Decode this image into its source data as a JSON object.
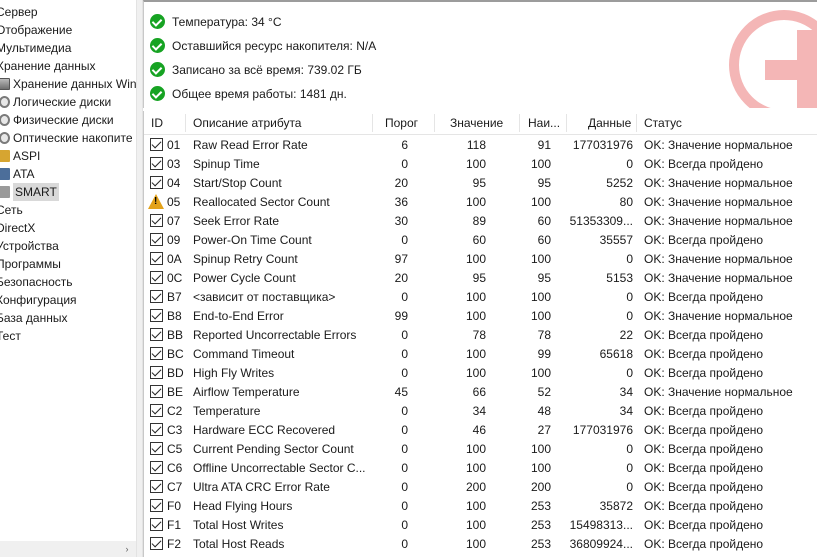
{
  "tree": {
    "items": [
      {
        "label": "Сервер",
        "indent": 0,
        "icon": ""
      },
      {
        "label": "Отображение",
        "indent": 0,
        "icon": ""
      },
      {
        "label": "Мультимедиа",
        "indent": 0,
        "icon": ""
      },
      {
        "label": "Хранение данных",
        "indent": 0,
        "icon": ""
      },
      {
        "label": "Хранение данных Win",
        "indent": 1,
        "icon": "hdd-icon"
      },
      {
        "label": "Логические диски",
        "indent": 1,
        "icon": "disk-icon"
      },
      {
        "label": "Физические диски",
        "indent": 1,
        "icon": "disk-icon"
      },
      {
        "label": "Оптические накопите",
        "indent": 1,
        "icon": "disk-icon"
      },
      {
        "label": "ASPI",
        "indent": 1,
        "icon": "folder-icon"
      },
      {
        "label": "ATA",
        "indent": 1,
        "icon": "chip-icon"
      },
      {
        "label": "SMART",
        "indent": 1,
        "icon": "smart-icon",
        "selected": true
      },
      {
        "label": "Сеть",
        "indent": 0,
        "icon": ""
      },
      {
        "label": "DirectX",
        "indent": 0,
        "icon": ""
      },
      {
        "label": "Устройства",
        "indent": 0,
        "icon": ""
      },
      {
        "label": "Программы",
        "indent": 0,
        "icon": ""
      },
      {
        "label": "Безопасность",
        "indent": 0,
        "icon": ""
      },
      {
        "label": "Конфигурация",
        "indent": 0,
        "icon": ""
      },
      {
        "label": "База данных",
        "indent": 0,
        "icon": ""
      },
      {
        "label": "Тест",
        "indent": 0,
        "icon": ""
      }
    ],
    "scroll_arrow": "›"
  },
  "info": {
    "rows": [
      {
        "text": "Температура: 34 °C",
        "icon": "ok-icon"
      },
      {
        "text": "Оставшийся ресурс накопителя: N/A",
        "icon": "ok-icon"
      },
      {
        "text": "Записано за всё время: 739.02 ГБ",
        "icon": "ok-icon"
      },
      {
        "text": "Общее время работы: 1481 дн.",
        "icon": "ok-icon"
      }
    ],
    "health_icon": "health-cross-icon"
  },
  "table": {
    "headers": {
      "id": "ID",
      "desc": "Описание атрибута",
      "threshold": "Порог",
      "value": "Значение",
      "worst": "Наи...",
      "data": "Данные",
      "status": "Статус"
    },
    "rows": [
      {
        "icon": "check",
        "id": "01",
        "desc": "Raw Read Error Rate",
        "threshold": "6",
        "value": "118",
        "worst": "91",
        "data": "177031976",
        "status": "OK: Значение нормальное"
      },
      {
        "icon": "check",
        "id": "03",
        "desc": "Spinup Time",
        "threshold": "0",
        "value": "100",
        "worst": "100",
        "data": "0",
        "status": "OK: Всегда пройдено"
      },
      {
        "icon": "check",
        "id": "04",
        "desc": "Start/Stop Count",
        "threshold": "20",
        "value": "95",
        "worst": "95",
        "data": "5252",
        "status": "OK: Значение нормальное"
      },
      {
        "icon": "warn",
        "id": "05",
        "desc": "Reallocated Sector Count",
        "threshold": "36",
        "value": "100",
        "worst": "100",
        "data": "80",
        "status": "OK: Значение нормальное"
      },
      {
        "icon": "check",
        "id": "07",
        "desc": "Seek Error Rate",
        "threshold": "30",
        "value": "89",
        "worst": "60",
        "data": "51353309...",
        "status": "OK: Значение нормальное"
      },
      {
        "icon": "check",
        "id": "09",
        "desc": "Power-On Time Count",
        "threshold": "0",
        "value": "60",
        "worst": "60",
        "data": "35557",
        "status": "OK: Всегда пройдено"
      },
      {
        "icon": "check",
        "id": "0A",
        "desc": "Spinup Retry Count",
        "threshold": "97",
        "value": "100",
        "worst": "100",
        "data": "0",
        "status": "OK: Значение нормальное"
      },
      {
        "icon": "check",
        "id": "0C",
        "desc": "Power Cycle Count",
        "threshold": "20",
        "value": "95",
        "worst": "95",
        "data": "5153",
        "status": "OK: Значение нормальное"
      },
      {
        "icon": "check",
        "id": "B7",
        "desc": "<зависит от поставщика>",
        "threshold": "0",
        "value": "100",
        "worst": "100",
        "data": "0",
        "status": "OK: Всегда пройдено"
      },
      {
        "icon": "check",
        "id": "B8",
        "desc": "End-to-End Error",
        "threshold": "99",
        "value": "100",
        "worst": "100",
        "data": "0",
        "status": "OK: Значение нормальное"
      },
      {
        "icon": "check",
        "id": "BB",
        "desc": "Reported Uncorrectable Errors",
        "threshold": "0",
        "value": "78",
        "worst": "78",
        "data": "22",
        "status": "OK: Всегда пройдено"
      },
      {
        "icon": "check",
        "id": "BC",
        "desc": "Command Timeout",
        "threshold": "0",
        "value": "100",
        "worst": "99",
        "data": "65618",
        "status": "OK: Всегда пройдено"
      },
      {
        "icon": "check",
        "id": "BD",
        "desc": "High Fly Writes",
        "threshold": "0",
        "value": "100",
        "worst": "100",
        "data": "0",
        "status": "OK: Всегда пройдено"
      },
      {
        "icon": "check",
        "id": "BE",
        "desc": "Airflow Temperature",
        "threshold": "45",
        "value": "66",
        "worst": "52",
        "data": "34",
        "status": "OK: Значение нормальное"
      },
      {
        "icon": "check",
        "id": "C2",
        "desc": "Temperature",
        "threshold": "0",
        "value": "34",
        "worst": "48",
        "data": "34",
        "status": "OK: Всегда пройдено"
      },
      {
        "icon": "check",
        "id": "C3",
        "desc": "Hardware ECC Recovered",
        "threshold": "0",
        "value": "46",
        "worst": "27",
        "data": "177031976",
        "status": "OK: Всегда пройдено"
      },
      {
        "icon": "check",
        "id": "C5",
        "desc": "Current Pending Sector Count",
        "threshold": "0",
        "value": "100",
        "worst": "100",
        "data": "0",
        "status": "OK: Всегда пройдено"
      },
      {
        "icon": "check",
        "id": "C6",
        "desc": "Offline Uncorrectable Sector C...",
        "threshold": "0",
        "value": "100",
        "worst": "100",
        "data": "0",
        "status": "OK: Всегда пройдено"
      },
      {
        "icon": "check",
        "id": "C7",
        "desc": "Ultra ATA CRC Error Rate",
        "threshold": "0",
        "value": "200",
        "worst": "200",
        "data": "0",
        "status": "OK: Всегда пройдено"
      },
      {
        "icon": "check",
        "id": "F0",
        "desc": "Head Flying Hours",
        "threshold": "0",
        "value": "100",
        "worst": "253",
        "data": "35872",
        "status": "OK: Всегда пройдено"
      },
      {
        "icon": "check",
        "id": "F1",
        "desc": "Total Host Writes",
        "threshold": "0",
        "value": "100",
        "worst": "253",
        "data": "15498313...",
        "status": "OK: Всегда пройдено"
      },
      {
        "icon": "check",
        "id": "F2",
        "desc": "Total Host Reads",
        "threshold": "0",
        "value": "100",
        "worst": "253",
        "data": "36809924...",
        "status": "OK: Всегда пройдено"
      }
    ]
  },
  "colors": {
    "ok_green": "#17a323",
    "warn_yellow": "#e3a21a",
    "health_pink": "#f4b6b6",
    "selection": "#d9d9d9"
  }
}
